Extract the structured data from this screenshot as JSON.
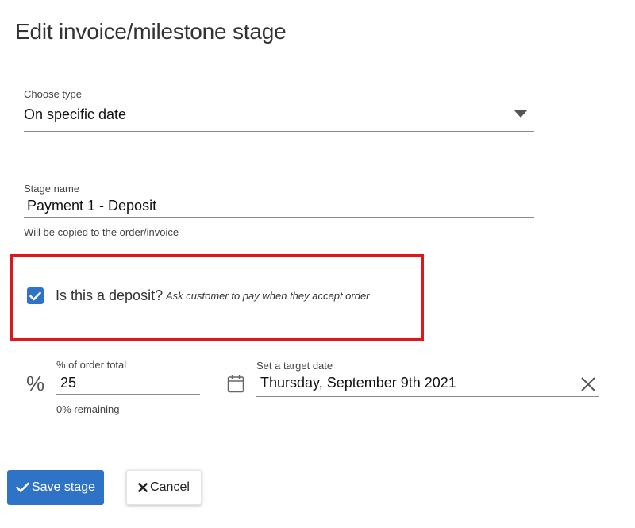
{
  "dialog": {
    "title": "Edit invoice/milestone stage"
  },
  "type_select": {
    "label": "Choose type",
    "value": "On specific date"
  },
  "stage_name": {
    "label": "Stage name",
    "value": "Payment 1 - Deposit",
    "helper": "Will be copied to the order/invoice"
  },
  "deposit": {
    "checked": true,
    "label": "Is this a deposit?",
    "hint": "Ask customer to pay when they accept order",
    "highlight_color": "#e0161b"
  },
  "percent": {
    "icon": "percent-icon",
    "label": "% of order total",
    "value": "25",
    "helper": "0% remaining"
  },
  "target_date": {
    "icon": "calendar-icon",
    "label": "Set a target date",
    "value": "Thursday, September 9th 2021",
    "clear_icon": "close-icon"
  },
  "actions": {
    "save_label": "Save stage",
    "cancel_label": "Cancel"
  },
  "colors": {
    "primary": "#2f73c7"
  }
}
